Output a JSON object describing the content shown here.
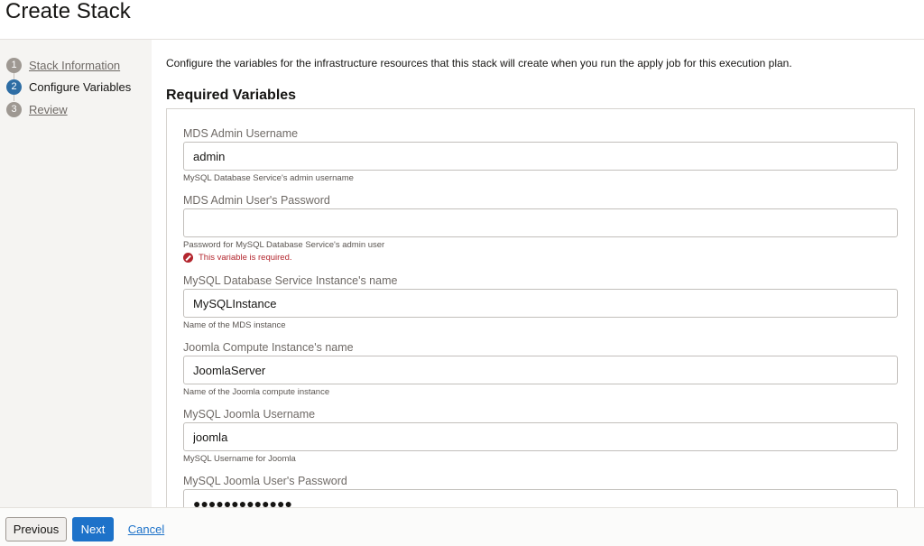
{
  "header": {
    "title": "Create Stack"
  },
  "steps": [
    {
      "number": "1",
      "label": "Stack Information",
      "state": "link"
    },
    {
      "number": "2",
      "label": "Configure Variables",
      "state": "active"
    },
    {
      "number": "3",
      "label": "Review",
      "state": "link"
    }
  ],
  "main": {
    "intro": "Configure the variables for the infrastructure resources that this stack will create when you run the apply job for this execution plan.",
    "section_title": "Required Variables",
    "fields": [
      {
        "label": "MDS Admin Username",
        "value": "admin",
        "hint": "MySQL Database Service's admin username"
      },
      {
        "label": "MDS Admin User's Password",
        "value": "",
        "hint": "Password for MySQL Database Service's admin user",
        "error": "This variable is required."
      },
      {
        "label": "MySQL Database Service Instance's name",
        "value": "MySQLInstance",
        "hint": "Name of the MDS instance"
      },
      {
        "label": "Joomla Compute Instance's name",
        "value": "JoomlaServer",
        "hint": "Name of the Joomla compute instance"
      },
      {
        "label": "MySQL Joomla Username",
        "value": "joomla",
        "hint": "MySQL Username for Joomla"
      },
      {
        "label": "MySQL Joomla User's Password",
        "value": "●●●●●●●●●●●●●"
      }
    ]
  },
  "footer": {
    "previous_label": "Previous",
    "next_label": "Next",
    "cancel_label": "Cancel"
  },
  "colors": {
    "primary": "#1d72c9",
    "error": "#b3262e",
    "active_step": "#2e6da4",
    "inactive_step": "#9e9892"
  }
}
